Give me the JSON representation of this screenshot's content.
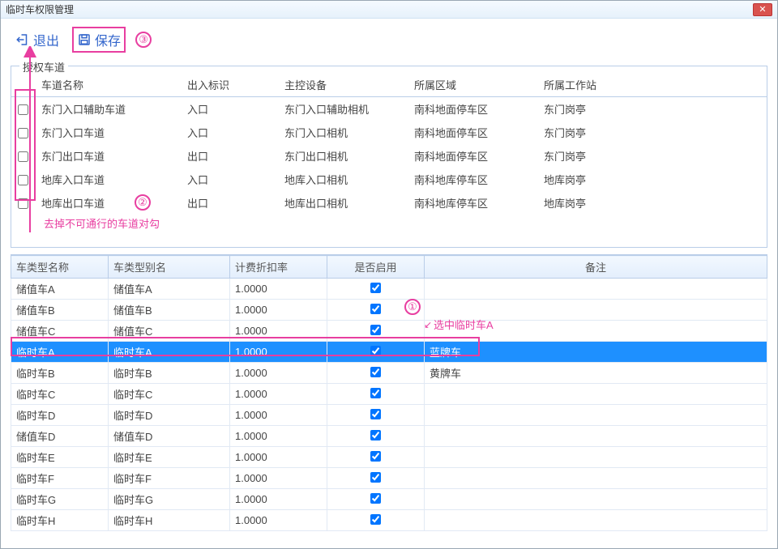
{
  "window": {
    "title": "临时车权限管理"
  },
  "toolbar": {
    "exit_label": "退出",
    "save_label": "保存"
  },
  "group": {
    "label": "授权车道"
  },
  "lane": {
    "headers": {
      "name": "车道名称",
      "io": "出入标识",
      "device": "主控设备",
      "area": "所属区域",
      "station": "所属工作站"
    },
    "rows": [
      {
        "name": "东门入口辅助车道",
        "io": "入口",
        "device": "东门入口辅助相机",
        "area": "南科地面停车区",
        "station": "东门岗亭"
      },
      {
        "name": "东门入口车道",
        "io": "入口",
        "device": "东门入口相机",
        "area": "南科地面停车区",
        "station": "东门岗亭"
      },
      {
        "name": "东门出口车道",
        "io": "出口",
        "device": "东门出口相机",
        "area": "南科地面停车区",
        "station": "东门岗亭"
      },
      {
        "name": "地库入口车道",
        "io": "入口",
        "device": "地库入口相机",
        "area": "南科地库停车区",
        "station": "地库岗亭"
      },
      {
        "name": "地库出口车道",
        "io": "出口",
        "device": "地库出口相机",
        "area": "南科地库停车区",
        "station": "地库岗亭"
      }
    ]
  },
  "type_table": {
    "headers": {
      "name": "车类型名称",
      "alias": "车类型别名",
      "rate": "计费折扣率",
      "enable": "是否启用",
      "remark": "备注"
    },
    "rows": [
      {
        "name": "储值车A",
        "alias": "储值车A",
        "rate": "1.0000",
        "enable": true,
        "remark": "",
        "selected": false
      },
      {
        "name": "储值车B",
        "alias": "储值车B",
        "rate": "1.0000",
        "enable": true,
        "remark": "",
        "selected": false
      },
      {
        "name": "储值车C",
        "alias": "储值车C",
        "rate": "1.0000",
        "enable": true,
        "remark": "",
        "selected": false
      },
      {
        "name": "临时车A",
        "alias": "临时车A",
        "rate": "1.0000",
        "enable": true,
        "remark": "蓝牌车",
        "selected": true
      },
      {
        "name": "临时车B",
        "alias": "临时车B",
        "rate": "1.0000",
        "enable": true,
        "remark": "黄牌车",
        "selected": false
      },
      {
        "name": "临时车C",
        "alias": "临时车C",
        "rate": "1.0000",
        "enable": true,
        "remark": "",
        "selected": false
      },
      {
        "name": "临时车D",
        "alias": "临时车D",
        "rate": "1.0000",
        "enable": true,
        "remark": "",
        "selected": false
      },
      {
        "name": "储值车D",
        "alias": "储值车D",
        "rate": "1.0000",
        "enable": true,
        "remark": "",
        "selected": false
      },
      {
        "name": "临时车E",
        "alias": "临时车E",
        "rate": "1.0000",
        "enable": true,
        "remark": "",
        "selected": false
      },
      {
        "name": "临时车F",
        "alias": "临时车F",
        "rate": "1.0000",
        "enable": true,
        "remark": "",
        "selected": false
      },
      {
        "name": "临时车G",
        "alias": "临时车G",
        "rate": "1.0000",
        "enable": true,
        "remark": "",
        "selected": false
      },
      {
        "name": "临时车H",
        "alias": "临时车H",
        "rate": "1.0000",
        "enable": true,
        "remark": "",
        "selected": false
      }
    ]
  },
  "annotations": {
    "step1": "①",
    "step2": "②",
    "step3": "③",
    "select_hint": "选中临时车A",
    "remove_hint": "去掉不可通行的车道对勾"
  }
}
